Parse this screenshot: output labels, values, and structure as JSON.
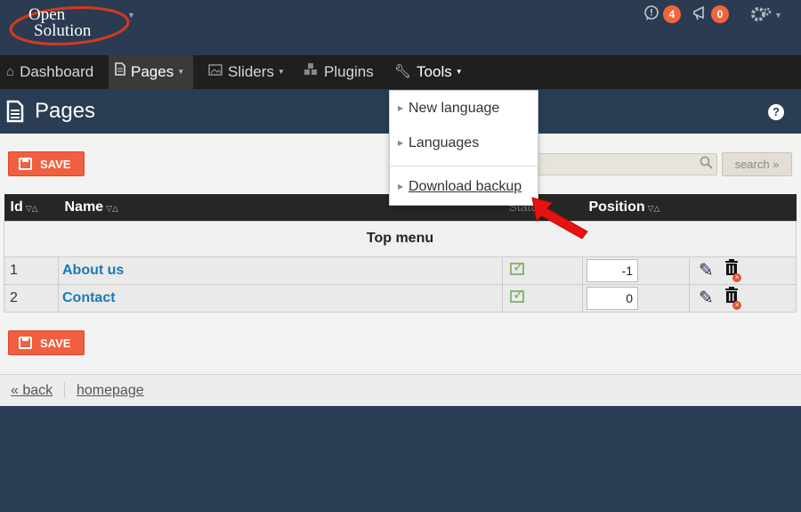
{
  "brand": {
    "logo_line1": "Open",
    "logo_line2": "Solution"
  },
  "topbar": {
    "comments_count": "4",
    "notifications_count": "0"
  },
  "nav": {
    "items": [
      {
        "label": "Dashboard"
      },
      {
        "label": "Pages"
      },
      {
        "label": "Sliders"
      },
      {
        "label": "Plugins"
      },
      {
        "label": "Tools"
      }
    ]
  },
  "page": {
    "title": "Pages",
    "help": "?"
  },
  "toolbar": {
    "save_label": "SAVE",
    "search_button": "search »"
  },
  "table": {
    "headers": {
      "id": "Id",
      "name": "Name",
      "status": "Statu",
      "position": "Position"
    },
    "group": "Top menu",
    "rows": [
      {
        "id": "1",
        "name": "About us",
        "position": "-1"
      },
      {
        "id": "2",
        "name": "Contact",
        "position": "0"
      }
    ]
  },
  "footer": {
    "back": "« back",
    "homepage": "homepage"
  },
  "tools_menu": {
    "items": [
      {
        "label": "New language"
      },
      {
        "label": "Languages"
      },
      {
        "label": "Download backup"
      }
    ]
  },
  "colors": {
    "accent": "#f05f3f",
    "link": "#1a7ab5",
    "header_bg": "#2b3d54",
    "nav_bg": "#1f1f1f"
  }
}
